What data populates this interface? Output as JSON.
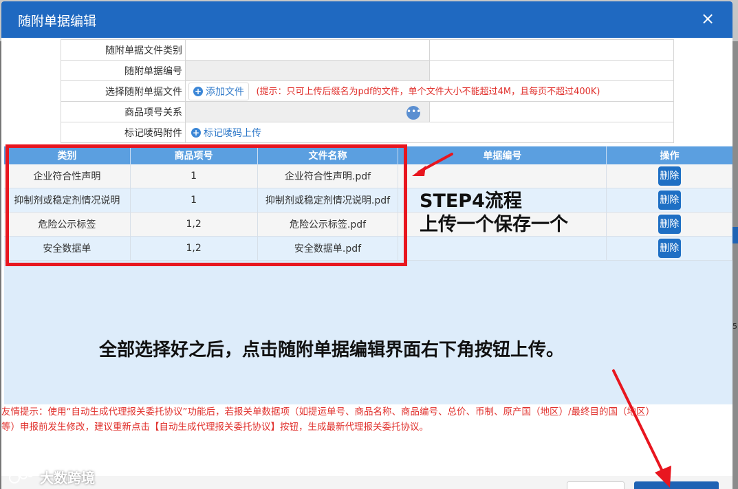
{
  "dialog": {
    "title": "随附单据编辑",
    "close_icon": "×"
  },
  "form": {
    "file_type_label": "随附单据文件类别",
    "doc_number_label": "随附单据编号",
    "select_file_label": "选择随附单据文件",
    "add_file_button": "添加文件",
    "upload_hint": "(提示：只可上传后缀名为pdf的文件，单个文件大小不能超过4M，且每页不超过400K)",
    "item_relation_label": "商品项号关系",
    "more_icon": "•••",
    "mark_label": "标记唛码附件",
    "mark_upload_button": "标记唛码上传"
  },
  "table": {
    "headers": [
      "类别",
      "商品项号",
      "文件名称",
      "单据编号",
      "操作"
    ],
    "rows": [
      {
        "category": "企业符合性声明",
        "item_no": "1",
        "file_name": "企业符合性声明.pdf",
        "doc_no": "",
        "action": "删除"
      },
      {
        "category": "抑制剂或稳定剂情况说明",
        "item_no": "1",
        "file_name": "抑制剂或稳定剂情况说明.pdf",
        "doc_no": "",
        "action": "删除"
      },
      {
        "category": "危险公示标签",
        "item_no": "1,2",
        "file_name": "危险公示标签.pdf",
        "doc_no": "",
        "action": "删除"
      },
      {
        "category": "安全数据单",
        "item_no": "1,2",
        "file_name": "安全数据单.pdf",
        "doc_no": "",
        "action": "删除"
      }
    ]
  },
  "annotations": {
    "step_line1": "STEP4流程",
    "step_line2": "上传一个保存一个",
    "instruction": "全部选择好之后，点击随附单据编辑界面右下角按钮上传。"
  },
  "notice": {
    "line1": "友情提示：使用“自动生成代理报关委托协议”功能后，若报关单数据项（如提运单号、商品名称、商品编号、总价、币制、原产国（地区）/最终目的国（地区）",
    "line2": "等）申报前发生修改，建议重新点击【自动生成代理报关委托协议】按钮，生成最新代理报关委托协议。"
  },
  "watermark": "大数跨境",
  "background": {
    "right_digit": "5"
  },
  "colors": {
    "title_bar": "#1f69c1",
    "table_header": "#5b9fe0",
    "delete_button": "#1e6fc4",
    "hint_red": "#e0302c",
    "annotation_red": "#e8161f"
  }
}
